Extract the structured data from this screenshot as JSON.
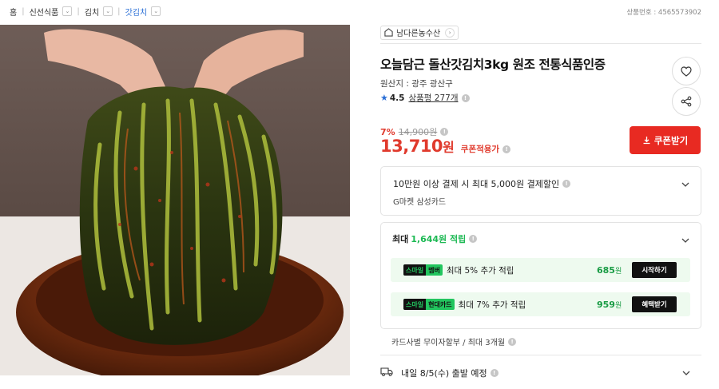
{
  "breadcrumb": [
    {
      "label": "홈",
      "has_dropdown": false
    },
    {
      "label": "신선식품",
      "has_dropdown": true
    },
    {
      "label": "김치",
      "has_dropdown": true
    },
    {
      "label": "갓김치",
      "has_dropdown": true
    }
  ],
  "product_no": "상품번호 : 4565573902",
  "seller": {
    "name": "남다른농수산"
  },
  "product": {
    "title": "오늘담근 돌산갓김치3kg 원조 전통식품인증",
    "origin": "원산지 : 광주 광산구",
    "rating": "4.5",
    "reviews": "상품평 277개"
  },
  "price": {
    "discount_rate": "7%",
    "original": "14,900원",
    "sale": "13,710",
    "unit": "원",
    "coupon_note": "쿠폰적용가"
  },
  "coupon_button": {
    "label": "쿠폰받기"
  },
  "card_benefit": {
    "line1": "10만원 이상 결제 시 최대 5,000원 결제할인",
    "line2": "G마켓 삼성카드"
  },
  "points": {
    "prefix": "최대",
    "amount": "1,644원 적립",
    "rows": [
      {
        "badge_a": "스마일",
        "badge_b": "멤버",
        "text": "최대 5% 추가 적립",
        "amount": "685",
        "unit": "원",
        "button": "시작하기"
      },
      {
        "badge_a": "스마일",
        "badge_b": "현대카드",
        "text": "최대 7% 추가 적립",
        "amount": "959",
        "unit": "원",
        "button": "혜택받기"
      }
    ]
  },
  "installment": "카드사별 무이자할부 / 최대 3개월",
  "delivery": {
    "text": "내일 8/5(수) 출발 예정"
  },
  "colors": {
    "accent_red": "#e03a2d",
    "coupon_red": "#e82a22",
    "smile_green": "#22c55e",
    "link_blue": "#2a6fd6"
  },
  "icons": [
    "store-icon",
    "chevron-right-icon",
    "heart-icon",
    "share-icon",
    "star-icon",
    "info-icon",
    "download-icon",
    "chevron-down-icon",
    "truck-icon"
  ]
}
